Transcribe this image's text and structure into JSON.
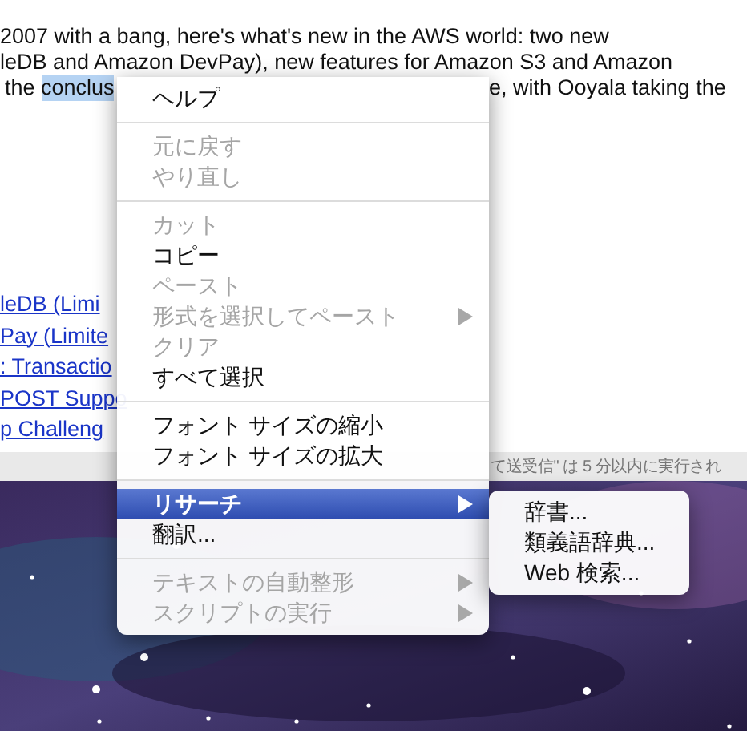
{
  "article": {
    "lines": [
      "2007 with a bang, here's what's new in the AWS world: two new",
      "leDB and Amazon DevPay), new features for Amazon S3 and Amazon"
    ],
    "partial_line": {
      "before": "the ",
      "selected_text": "conclus",
      "after": "e, with Ooyala taking the"
    },
    "links": [
      "leDB (Limi",
      "Pay (Limite",
      ": Transactio",
      "POST Suppo",
      "p Challeng"
    ]
  },
  "status_bar": {
    "text": "て送受信\" は 5 分以内に実行され"
  },
  "context_menu": {
    "groups": [
      [
        {
          "label": "ヘルプ",
          "disabled": false,
          "has_submenu": false,
          "selected": false
        }
      ],
      [
        {
          "label": "元に戻す",
          "disabled": true,
          "has_submenu": false,
          "selected": false
        },
        {
          "label": "やり直し",
          "disabled": true,
          "has_submenu": false,
          "selected": false
        }
      ],
      [
        {
          "label": "カット",
          "disabled": true,
          "has_submenu": false,
          "selected": false
        },
        {
          "label": "コピー",
          "disabled": false,
          "has_submenu": false,
          "selected": false
        },
        {
          "label": "ペースト",
          "disabled": true,
          "has_submenu": false,
          "selected": false
        },
        {
          "label": "形式を選択してペースト",
          "disabled": true,
          "has_submenu": true,
          "selected": false
        },
        {
          "label": "クリア",
          "disabled": true,
          "has_submenu": false,
          "selected": false
        },
        {
          "label": "すべて選択",
          "disabled": false,
          "has_submenu": false,
          "selected": false
        }
      ],
      [
        {
          "label": "フォント サイズの縮小",
          "disabled": false,
          "has_submenu": false,
          "selected": false
        },
        {
          "label": "フォント サイズの拡大",
          "disabled": false,
          "has_submenu": false,
          "selected": false
        }
      ],
      [
        {
          "label": "リサーチ",
          "disabled": false,
          "has_submenu": true,
          "selected": true
        },
        {
          "label": "翻訳...",
          "disabled": false,
          "has_submenu": false,
          "selected": false
        }
      ],
      [
        {
          "label": "テキストの自動整形",
          "disabled": true,
          "has_submenu": true,
          "selected": false
        },
        {
          "label": "スクリプトの実行",
          "disabled": true,
          "has_submenu": true,
          "selected": false
        }
      ]
    ]
  },
  "submenu": {
    "items": [
      {
        "label": "辞書...",
        "selected": false
      },
      {
        "label": "類義語辞典...",
        "selected": false
      },
      {
        "label": "Web 検索...",
        "selected": false
      }
    ]
  }
}
